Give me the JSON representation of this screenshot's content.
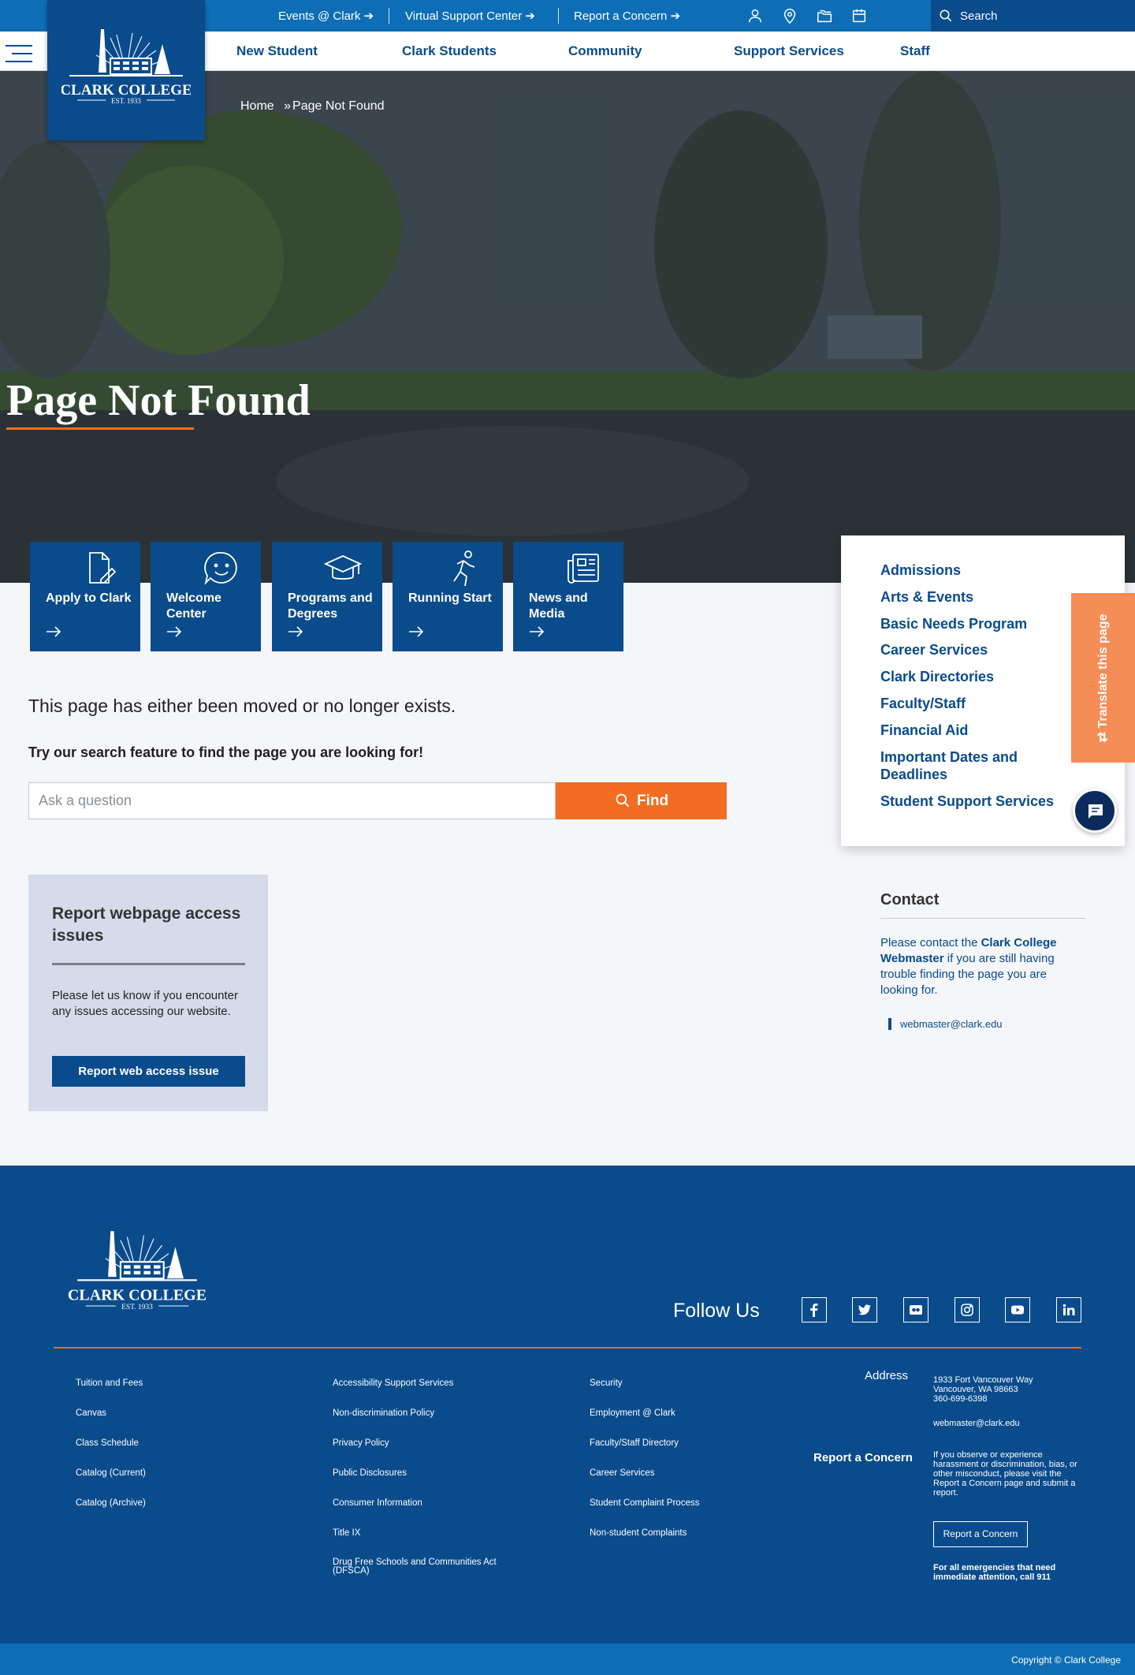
{
  "topbar": {
    "links": [
      "Events @ Clark",
      "Virtual Support Center",
      "Report a Concern"
    ],
    "search_placeholder": "Search"
  },
  "nav": {
    "items": [
      "New Student",
      "Clark Students",
      "Community",
      "Support Services",
      "Staff"
    ]
  },
  "logo": {
    "name": "CLARK COLLEGE",
    "est": "EST. 1933"
  },
  "breadcrumb": {
    "home": "Home",
    "sep": "»",
    "current": "Page Not Found"
  },
  "hero": {
    "title": "Page Not Found"
  },
  "tiles": [
    {
      "label": "Apply to Clark",
      "icon": "document-pen-icon"
    },
    {
      "label": "Welcome Center",
      "icon": "smile-bubble-icon"
    },
    {
      "label": "Programs and Degrees",
      "icon": "graduation-cap-icon"
    },
    {
      "label": "Running Start",
      "icon": "runner-icon"
    },
    {
      "label": "News and Media",
      "icon": "newspaper-icon"
    }
  ],
  "main": {
    "message": "This page has either been moved or no longer exists.",
    "hint": "Try our search feature to find the page you are looking for!",
    "search_placeholder": "Ask a question",
    "find_label": "Find"
  },
  "report": {
    "title": "Report webpage access issues",
    "text": "Please let us know if you encounter any issues accessing our website.",
    "button": "Report web access issue"
  },
  "sidebar": {
    "links": [
      "Admissions",
      "Arts & Events",
      "Basic Needs Program",
      "Career Services",
      "Clark Directories",
      "Faculty/Staff",
      "Financial Aid",
      "Important Dates and Deadlines",
      "Student Support Services"
    ],
    "translate": "Translate this page"
  },
  "contact": {
    "heading": "Contact",
    "text_pre": "Please contact the ",
    "text_bold": "Clark College Webmaster",
    "text_post": " if you are still having trouble finding the page you are looking for.",
    "email": "webmaster@clark.edu"
  },
  "footer": {
    "follow": "Follow Us",
    "social": [
      "facebook-icon",
      "twitter-icon",
      "flickr-icon",
      "instagram-icon",
      "youtube-icon",
      "linkedin-icon"
    ],
    "col1": [
      "Tuition and Fees",
      "Canvas",
      "Class Schedule",
      "Catalog (Current)",
      "Catalog (Archive)"
    ],
    "col2": [
      "Accessibility Support Services",
      "Non-discrimination Policy",
      "Privacy Policy",
      "Public Disclosures",
      "Consumer Information",
      "Title IX",
      "Drug Free Schools and Communities Act (DFSCA)"
    ],
    "col3": [
      "Security",
      "Employment @ Clark",
      "Faculty/Staff Directory",
      "Career Services",
      "Student Complaint Process",
      "Non-student Complaints"
    ],
    "address_label": "Address",
    "address_lines": [
      "1933 Fort Vancouver Way",
      "Vancouver, WA 98663",
      "360-699-6398"
    ],
    "email": "webmaster@clark.edu",
    "concern_label": "Report a Concern",
    "concern_text": "If you observe or experience harassment or discrimination, bias, or other misconduct, please visit the Report a Concern page and submit a report.",
    "concern_button": "Report a Concern",
    "emergency": "For all emergencies that need immediate attention, call 911",
    "copyright": "Copyright © Clark College"
  },
  "colors": {
    "primary": "#0a4b8c",
    "topbar": "#0e6eb5",
    "accent": "#f26d21",
    "translate": "#f58d57"
  }
}
